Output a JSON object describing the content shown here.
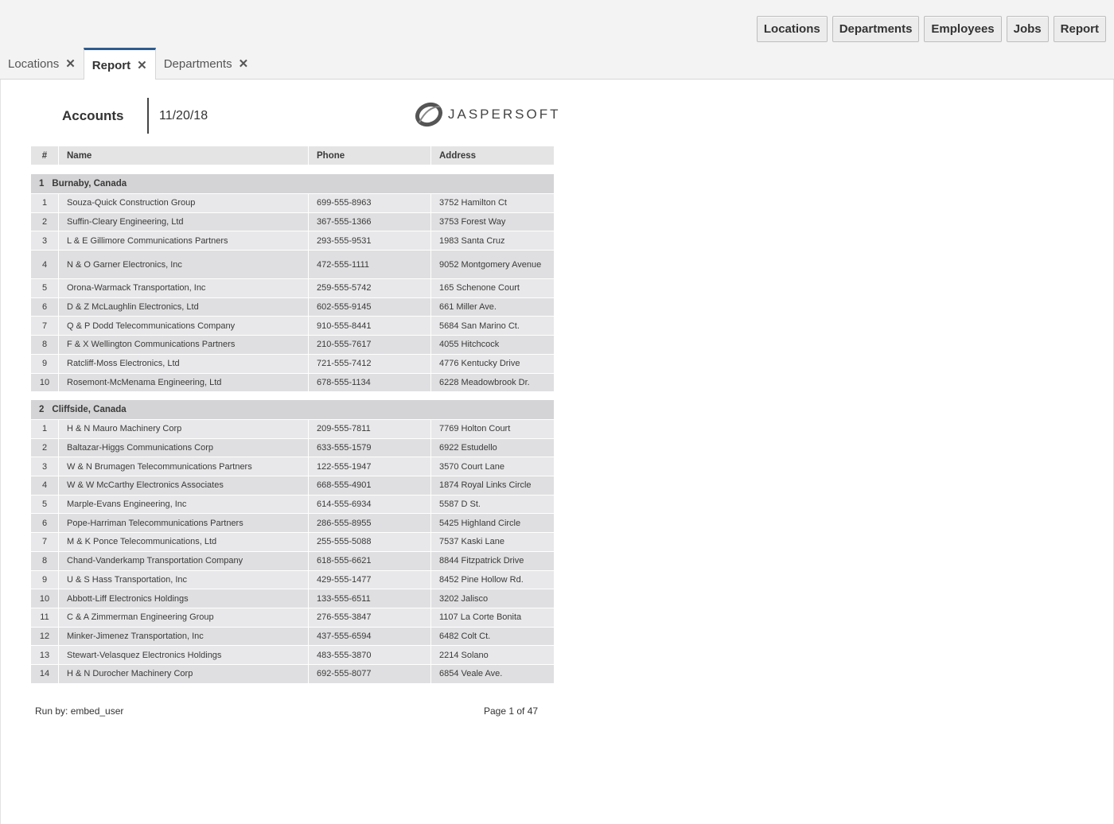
{
  "nav": {
    "buttons": [
      "Locations",
      "Departments",
      "Employees",
      "Jobs",
      "Report"
    ]
  },
  "tabs": [
    {
      "label": "Locations",
      "active": false
    },
    {
      "label": "Report",
      "active": true
    },
    {
      "label": "Departments",
      "active": false
    }
  ],
  "tab_close_glyph": "✕",
  "report": {
    "title": "Accounts",
    "date": "11/20/18",
    "logo_text": "JASPERSOFT",
    "columns": [
      "#",
      "Name",
      "Phone",
      "Address"
    ],
    "groups": [
      {
        "number": "1",
        "name": "Burnaby, Canada",
        "rows": [
          [
            "1",
            "Souza-Quick Construction Group",
            "699-555-8963",
            "3752 Hamilton Ct"
          ],
          [
            "2",
            "Suffin-Cleary Engineering, Ltd",
            "367-555-1366",
            "3753 Forest Way"
          ],
          [
            "3",
            "L & E Gillimore Communications Partners",
            "293-555-9531",
            "1983 Santa Cruz"
          ],
          [
            "4",
            "N & O Garner Electronics, Inc",
            "472-555-1111",
            "9052 Montgomery Avenue"
          ],
          [
            "5",
            "Orona-Warmack Transportation, Inc",
            "259-555-5742",
            "165 Schenone Court"
          ],
          [
            "6",
            "D & Z McLaughlin Electronics, Ltd",
            "602-555-9145",
            "661 Miller Ave."
          ],
          [
            "7",
            "Q & P Dodd Telecommunications Company",
            "910-555-8441",
            "5684 San Marino Ct."
          ],
          [
            "8",
            "F & X Wellington Communications Partners",
            "210-555-7617",
            "4055 Hitchcock"
          ],
          [
            "9",
            "Ratcliff-Moss Electronics, Ltd",
            "721-555-7412",
            "4776 Kentucky Drive"
          ],
          [
            "10",
            "Rosemont-McMenama Engineering, Ltd",
            "678-555-1134",
            "6228 Meadowbrook Dr."
          ]
        ]
      },
      {
        "number": "2",
        "name": "Cliffside, Canada",
        "rows": [
          [
            "1",
            "H & N Mauro Machinery Corp",
            "209-555-7811",
            "7769 Holton Court"
          ],
          [
            "2",
            "Baltazar-Higgs Communications Corp",
            "633-555-1579",
            "6922 Estudello"
          ],
          [
            "3",
            "W & N Brumagen Telecommunications Partners",
            "122-555-1947",
            "3570 Court Lane"
          ],
          [
            "4",
            "W & W McCarthy Electronics Associates",
            "668-555-4901",
            "1874 Royal Links Circle"
          ],
          [
            "5",
            "Marple-Evans Engineering, Inc",
            "614-555-6934",
            "5587 D St."
          ],
          [
            "6",
            "Pope-Harriman Telecommunications Partners",
            "286-555-8955",
            "5425 Highland Circle"
          ],
          [
            "7",
            "M & K Ponce Telecommunications, Ltd",
            "255-555-5088",
            "7537 Kaski Lane"
          ],
          [
            "8",
            "Chand-Vanderkamp Transportation Company",
            "618-555-6621",
            "8844 Fitzpatrick Drive"
          ],
          [
            "9",
            "U & S Hass Transportation, Inc",
            "429-555-1477",
            "8452 Pine Hollow Rd."
          ],
          [
            "10",
            "Abbott-Liff Electronics Holdings",
            "133-555-6511",
            "3202 Jalisco"
          ],
          [
            "11",
            "C & A Zimmerman Engineering Group",
            "276-555-3847",
            "1107 La Corte Bonita"
          ],
          [
            "12",
            "Minker-Jimenez Transportation, Inc",
            "437-555-6594",
            "6482 Colt Ct."
          ],
          [
            "13",
            "Stewart-Velasquez Electronics Holdings",
            "483-555-3870",
            "2214 Solano"
          ],
          [
            "14",
            "H & N Durocher Machinery Corp",
            "692-555-8077",
            "6854 Veale Ave."
          ]
        ]
      }
    ],
    "run_by": "Run by: embed_user",
    "page_info": "Page 1 of 47"
  }
}
